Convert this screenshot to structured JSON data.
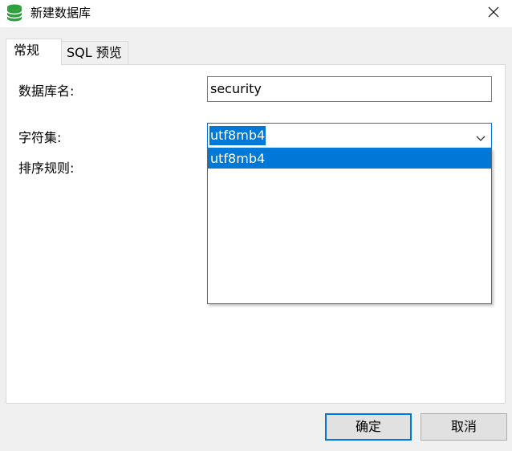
{
  "window": {
    "title": "新建数据库",
    "icon": "database-icon",
    "close_icon": "close-icon"
  },
  "tabs": [
    {
      "label": "常规",
      "active": true
    },
    {
      "label": "SQL 预览",
      "active": false
    }
  ],
  "form": {
    "database_name_label": "数据库名:",
    "database_name_value": "security",
    "charset_label": "字符集:",
    "charset_value": "utf8mb4",
    "charset_options": [
      "utf8mb4"
    ],
    "collation_label": "排序规则:"
  },
  "buttons": {
    "ok_label": "确定",
    "cancel_label": "取消"
  },
  "colors": {
    "accent": "#0078d7",
    "icon_green": "#2e9e3e"
  }
}
